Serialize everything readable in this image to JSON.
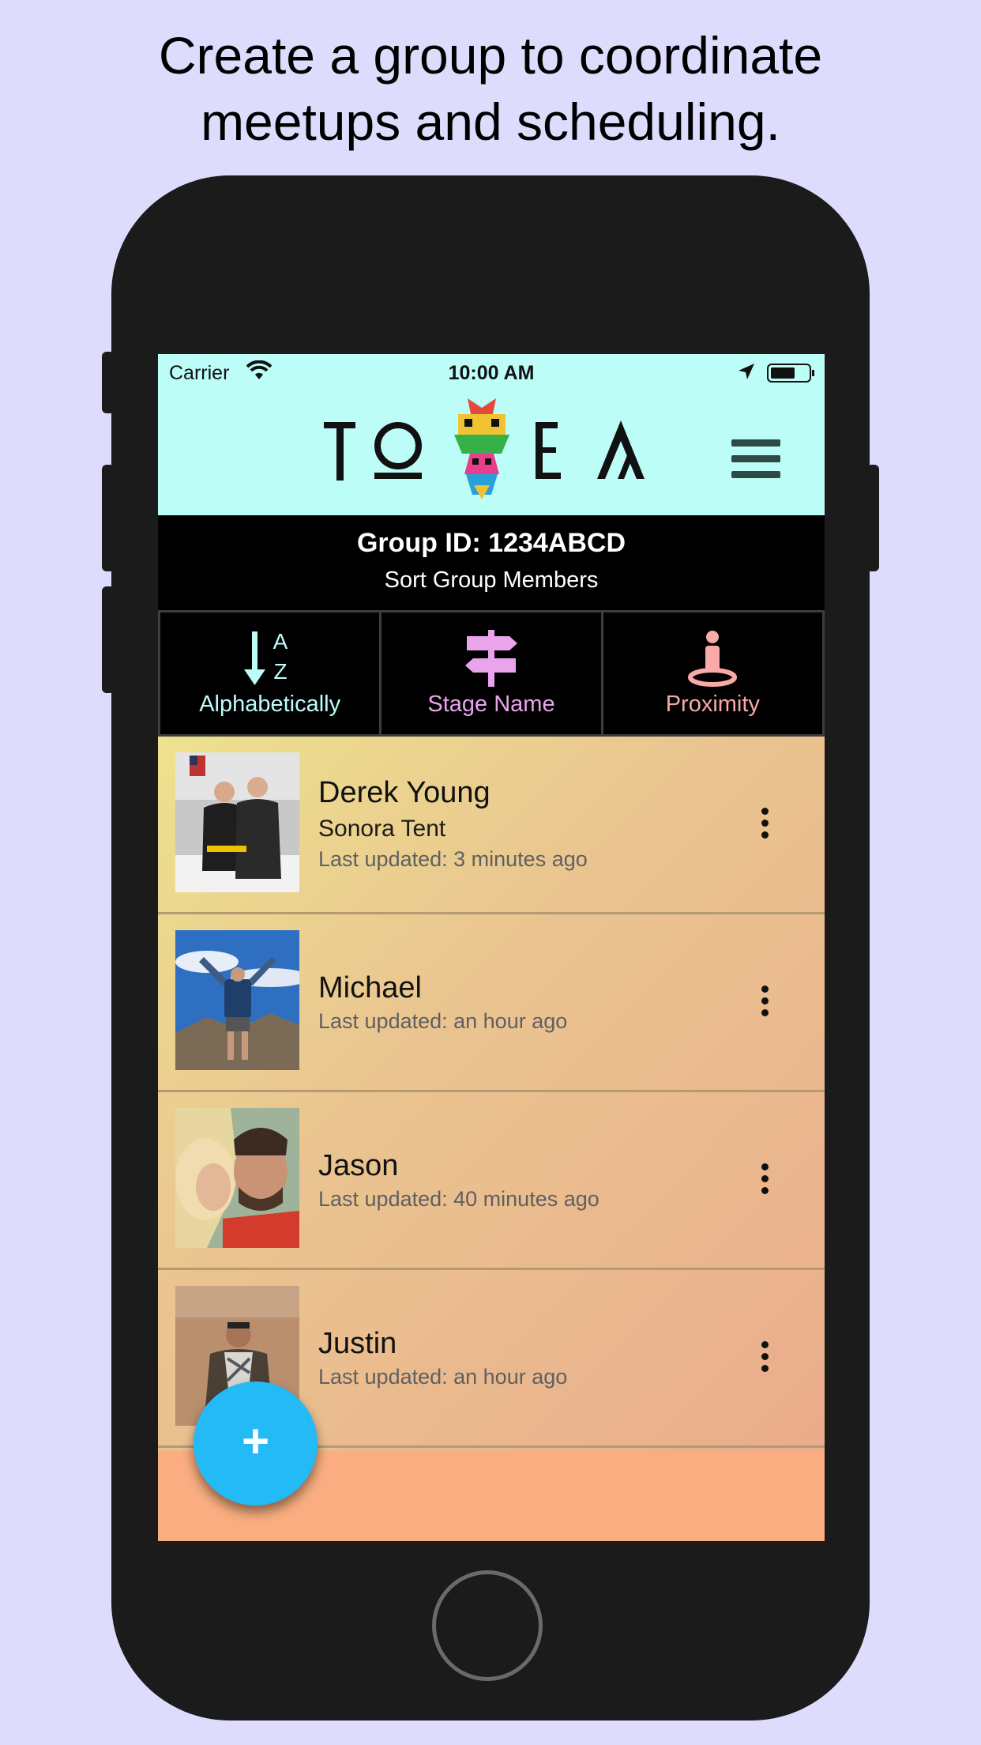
{
  "caption": {
    "line1": "Create a group to coordinate",
    "line2": "meetups and scheduling."
  },
  "status_bar": {
    "carrier": "Carrier",
    "time": "10:00 AM",
    "icons": [
      "wifi-icon",
      "location-arrow-icon",
      "battery-icon"
    ]
  },
  "header": {
    "logo_text": "TOTEM",
    "menu_icon": "hamburger-menu-icon"
  },
  "group": {
    "id_label": "Group ID: 1234ABCD",
    "sort_title": "Sort Group Members"
  },
  "sort_options": [
    {
      "label": "Alphabetically",
      "icon": "sort-az-icon",
      "color": "#bdfdf8"
    },
    {
      "label": "Stage Name",
      "icon": "signpost-icon",
      "color": "#e9a4ec"
    },
    {
      "label": "Proximity",
      "icon": "person-pin-icon",
      "color": "#f7aaa8"
    }
  ],
  "members": [
    {
      "name": "Derek Young",
      "stage": "Sonora Tent",
      "updated": "Last updated: 3 minutes ago"
    },
    {
      "name": "Michael",
      "stage": "",
      "updated": "Last updated: an hour ago"
    },
    {
      "name": "Jason",
      "stage": "",
      "updated": "Last updated: 40 minutes ago"
    },
    {
      "name": "Justin",
      "stage": "",
      "updated": "Last updated: an hour ago"
    }
  ],
  "fab": {
    "label": "+",
    "icon": "add-icon"
  },
  "colors": {
    "background": "#dddcfd",
    "header": "#bdfdf8",
    "fab": "#24baf5",
    "list_bottom": "#f9ad80"
  }
}
